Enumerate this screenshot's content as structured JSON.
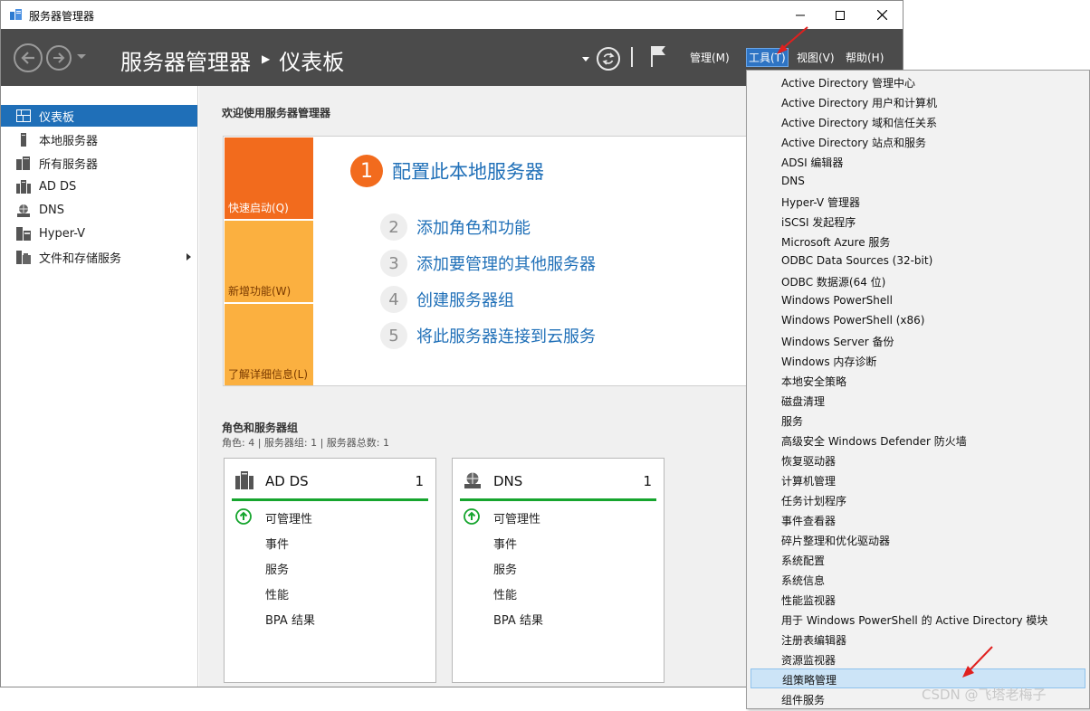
{
  "window": {
    "title": "服务器管理器"
  },
  "header": {
    "breadcrumb_root": "服务器管理器",
    "breadcrumb_current": "仪表板",
    "menus": [
      "管理(M)",
      "工具(T)",
      "视图(V)",
      "帮助(H)"
    ],
    "active_menu": "工具(T)"
  },
  "sidebar": {
    "items": [
      {
        "label": "仪表板",
        "icon": "dashboard-icon",
        "selected": true
      },
      {
        "label": "本地服务器",
        "icon": "local-server-icon"
      },
      {
        "label": "所有服务器",
        "icon": "all-servers-icon"
      },
      {
        "label": "AD DS",
        "icon": "adds-icon"
      },
      {
        "label": "DNS",
        "icon": "dns-icon"
      },
      {
        "label": "Hyper-V",
        "icon": "hyperv-icon"
      },
      {
        "label": "文件和存储服务",
        "icon": "file-storage-icon",
        "has_submenu": true
      }
    ]
  },
  "welcome": {
    "title": "欢迎使用服务器管理器",
    "tiles": [
      "快速启动(Q)",
      "新增功能(W)",
      "了解详细信息(L)"
    ],
    "steps": [
      {
        "num": "1",
        "label": "配置此本地服务器"
      },
      {
        "num": "2",
        "label": "添加角色和功能"
      },
      {
        "num": "3",
        "label": "添加要管理的其他服务器"
      },
      {
        "num": "4",
        "label": "创建服务器组"
      },
      {
        "num": "5",
        "label": "将此服务器连接到云服务"
      }
    ]
  },
  "roles": {
    "title": "角色和服务器组",
    "subtitle": "角色: 4 | 服务器组: 1 | 服务器总数: 1",
    "cards": [
      {
        "name": "AD DS",
        "count": "1",
        "rows": [
          "可管理性",
          "事件",
          "服务",
          "性能",
          "BPA 结果"
        ]
      },
      {
        "name": "DNS",
        "count": "1",
        "rows": [
          "可管理性",
          "事件",
          "服务",
          "性能",
          "BPA 结果"
        ]
      }
    ]
  },
  "tools_menu": {
    "items": [
      "Active Directory 管理中心",
      "Active Directory 用户和计算机",
      "Active Directory 域和信任关系",
      "Active Directory 站点和服务",
      "ADSI 编辑器",
      "DNS",
      "Hyper-V 管理器",
      "iSCSI 发起程序",
      "Microsoft Azure 服务",
      "ODBC Data Sources (32-bit)",
      "ODBC 数据源(64 位)",
      "Windows PowerShell",
      "Windows PowerShell (x86)",
      "Windows Server 备份",
      "Windows 内存诊断",
      "本地安全策略",
      "磁盘清理",
      "服务",
      "高级安全 Windows Defender 防火墙",
      "恢复驱动器",
      "计算机管理",
      "任务计划程序",
      "事件查看器",
      "碎片整理和优化驱动器",
      "系统配置",
      "系统信息",
      "性能监视器",
      "用于 Windows PowerShell 的 Active Directory 模块",
      "注册表编辑器",
      "资源监视器",
      "组策略管理",
      "组件服务"
    ],
    "highlighted_item": "组策略管理"
  },
  "colors": {
    "header_bg": "#4b4b4b",
    "selected_blue": "#1f6fb8",
    "quickstart_orange": "#f26b1d",
    "tile_light_orange": "#fbb040",
    "link_blue": "#2070b8",
    "status_green": "#16a52e",
    "annotation_red": "#e0201e"
  },
  "watermark": "CSDN @飞塔老梅子"
}
